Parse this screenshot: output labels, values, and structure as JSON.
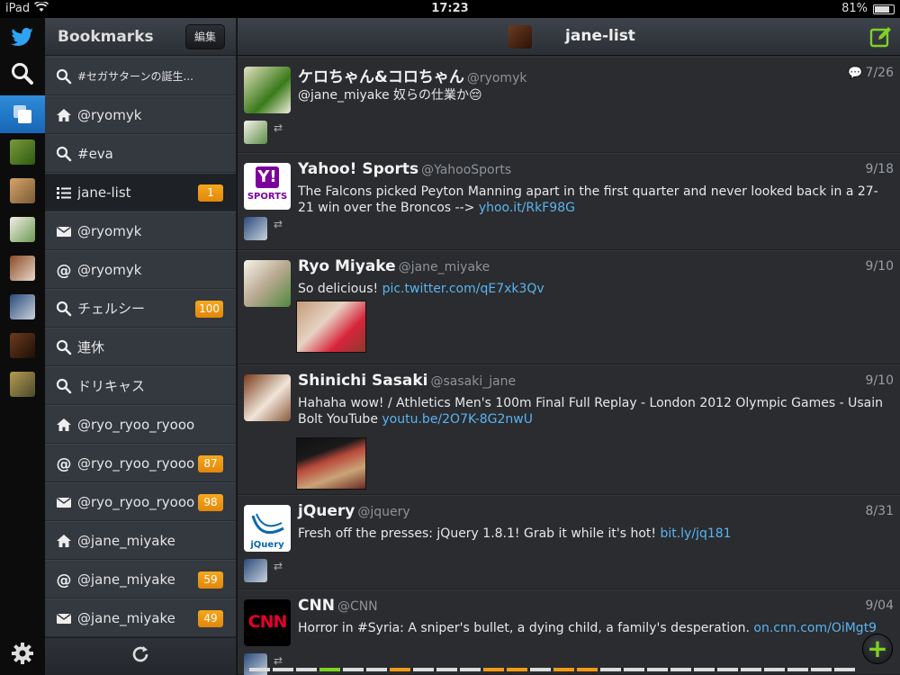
{
  "status": {
    "carrier": "iPad",
    "time": "17:23",
    "battery": "81%"
  },
  "rail": {
    "icons": [
      "twitter-bird-icon",
      "search-icon",
      "bookmarks-icon",
      "settings-icon"
    ],
    "accounts": [
      "frog-avatar",
      "cat-avatar",
      "ryo-avatar",
      "dog-avatar",
      "robot-avatar",
      "portrait-avatar",
      "tiger-avatar"
    ]
  },
  "panel": {
    "title": "Bookmarks",
    "edit_label": "編集",
    "items": [
      {
        "icon": "search",
        "label": "#セガサターンの誕生...",
        "badge": ""
      },
      {
        "icon": "home",
        "label": "@ryomyk",
        "badge": ""
      },
      {
        "icon": "search",
        "label": "#eva",
        "badge": ""
      },
      {
        "icon": "list",
        "label": "jane-list",
        "badge": "1"
      },
      {
        "icon": "mail",
        "label": "@ryomyk",
        "badge": ""
      },
      {
        "icon": "at",
        "label": "@ryomyk",
        "badge": ""
      },
      {
        "icon": "search",
        "label": "チェルシー",
        "badge": "100"
      },
      {
        "icon": "search",
        "label": "連休",
        "badge": ""
      },
      {
        "icon": "search",
        "label": "ドリキャス",
        "badge": ""
      },
      {
        "icon": "home",
        "label": "@ryo_ryoo_ryooo",
        "badge": ""
      },
      {
        "icon": "at",
        "label": "@ryo_ryoo_ryooo",
        "badge": "87"
      },
      {
        "icon": "mail",
        "label": "@ryo_ryoo_ryooo",
        "badge": "98"
      },
      {
        "icon": "home",
        "label": "@jane_miyake",
        "badge": ""
      },
      {
        "icon": "at",
        "label": "@jane_miyake",
        "badge": "59"
      },
      {
        "icon": "mail",
        "label": "@jane_miyake",
        "badge": "49"
      }
    ]
  },
  "main": {
    "list_title": "jane-list",
    "tweets": [
      {
        "name": "ケロちゃん&コロちゃん",
        "handle": "@ryomyk",
        "date": "7/26",
        "replies": true,
        "text": "@jane_miyake 奴らの仕業か😔",
        "link": "",
        "avatar": "frog"
      },
      {
        "name": "Yahoo! Sports",
        "handle": "@YahooSports",
        "date": "9/18",
        "text": "The Falcons picked Peyton Manning apart in the first quarter and never looked back in a 27-21 win over the Broncos --> ",
        "link": "yhoo.it/RkF98G",
        "avatar": "yahoo"
      },
      {
        "name": "Ryo Miyake",
        "handle": "@jane_miyake",
        "date": "9/10",
        "text": "So delicious! ",
        "link": "pic.twitter.com/qE7xk3Qv",
        "avatar": "ryo"
      },
      {
        "name": "Shinichi Sasaki",
        "handle": "@sasaki_jane",
        "date": "9/10",
        "text": "Hahaha wow! / Athletics Men's 100m Final Full Replay - London 2012 Olympic Games - Usain Bolt YouTube ",
        "link": "youtu.be/2O7K-8G2nwU",
        "avatar": "dog"
      },
      {
        "name": "jQuery",
        "handle": "@jquery",
        "date": "8/31",
        "text": "Fresh off the presses: jQuery 1.8.1! Grab it while it's hot! ",
        "link": "bit.ly/jq181",
        "avatar": "jquery"
      },
      {
        "name": "CNN",
        "handle": "@CNN",
        "date": "9/04",
        "text": "Horror in #Syria: A sniper's bullet, a dying child, a family's desperation. ",
        "link": "on.cnn.com/OiMgt9",
        "avatar": "cnn"
      }
    ],
    "yahoo_logo_text": "SPORTS",
    "cnn_logo_text": "CNN"
  },
  "colors": {
    "accent": "#2ea3f2",
    "badge": "#f29a14",
    "link": "#5bb3f0",
    "compose": "#7ed321"
  },
  "ticks": [
    "#dcdcdc",
    "#dcdcdc",
    "#dcdcdc",
    "#7ed321",
    "#dcdcdc",
    "#dcdcdc",
    "#f29a14",
    "#dcdcdc",
    "#dcdcdc",
    "#dcdcdc",
    "#f29a14",
    "#f29a14",
    "#dcdcdc",
    "#f29a14",
    "#f29a14",
    "#dcdcdc",
    "#dcdcdc",
    "#dcdcdc",
    "#dcdcdc",
    "#dcdcdc",
    "#dcdcdc",
    "#dcdcdc",
    "#dcdcdc",
    "#dcdcdc",
    "#dcdcdc",
    "#dcdcdc"
  ]
}
